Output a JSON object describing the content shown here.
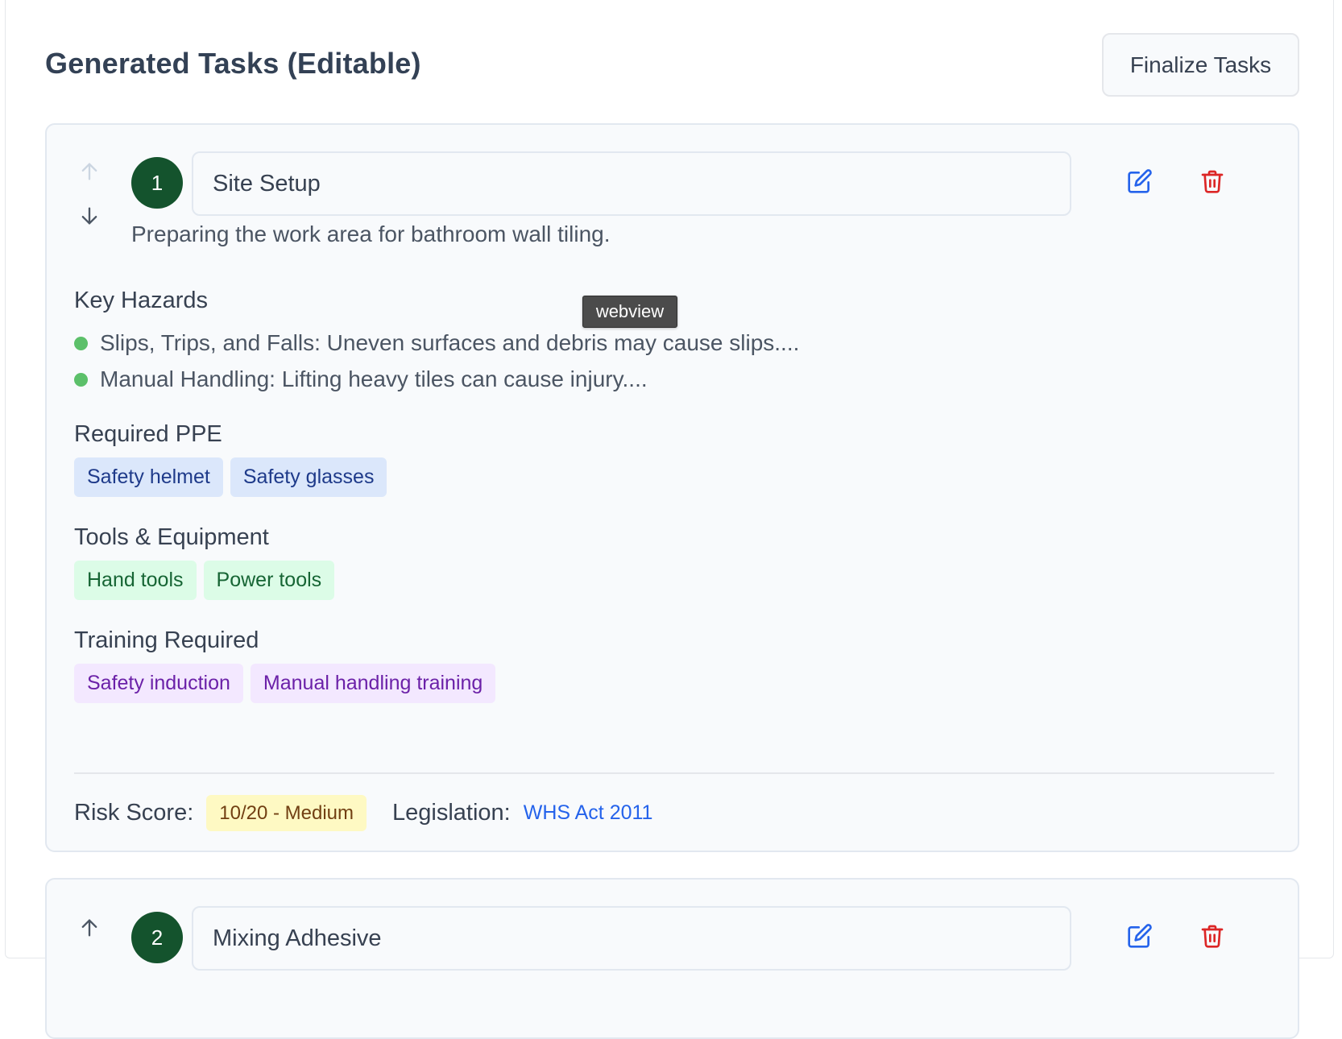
{
  "header": {
    "title": "Generated Tasks (Editable)",
    "finalize_label": "Finalize Tasks"
  },
  "tooltip": {
    "text": "webview"
  },
  "tasks": [
    {
      "number": "1",
      "title": "Site Setup",
      "description": "Preparing the work area for bathroom wall tiling.",
      "hazards_label": "Key Hazards",
      "hazards": [
        "Slips, Trips, and Falls: Uneven surfaces and debris may cause slips....",
        "Manual Handling: Lifting heavy tiles can cause injury...."
      ],
      "ppe_label": "Required PPE",
      "ppe": [
        "Safety helmet",
        "Safety glasses"
      ],
      "tools_label": "Tools & Equipment",
      "tools": [
        "Hand tools",
        "Power tools"
      ],
      "training_label": "Training Required",
      "training": [
        "Safety induction",
        "Manual handling training"
      ],
      "risk_label": "Risk Score:",
      "risk_value": "10/20 - Medium",
      "legislation_label": "Legislation:",
      "legislation_value": "WHS Act 2011"
    },
    {
      "number": "2",
      "title": "Mixing Adhesive"
    }
  ],
  "colors": {
    "step_circle": "#14532d",
    "hazard_dot": "#5cc06a",
    "edit_icon": "#2563eb",
    "delete_icon": "#dc2626",
    "ppe_tag_bg": "#dbe7fb",
    "tool_tag_bg": "#dcfce7",
    "training_tag_bg": "#f3e8ff",
    "risk_badge_bg": "#fef9c3",
    "link": "#2563eb"
  },
  "icons": {
    "move_up": "arrow-up-icon",
    "move_down": "arrow-down-icon",
    "edit": "edit-icon",
    "delete": "trash-icon"
  }
}
